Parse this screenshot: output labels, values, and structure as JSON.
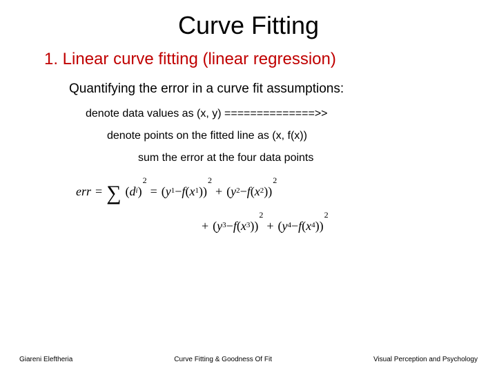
{
  "title": "Curve Fitting",
  "subtitle": "1. Linear curve fitting (linear regression)",
  "lines": {
    "l1": "Quantifying the error in a curve fit assumptions:",
    "l2": "denote data values as (x, y) ==============>>",
    "l3": "denote points on the fitted line as (x, f(x))",
    "l4": "sum the error at the four data points"
  },
  "equation": {
    "lhs_err": "err",
    "eq": "=",
    "sum": "∑",
    "d_open": "(",
    "d_var": "d",
    "d_sub": "i",
    "d_close": ")",
    "sq": "2",
    "y": "y",
    "f": "f",
    "x": "x",
    "minus": "−",
    "plus": "+",
    "open": "(",
    "close": ")",
    "s1": "1",
    "s2": "2",
    "s3": "3",
    "s4": "4"
  },
  "footer": {
    "left": "Giareni Eleftheria",
    "center": "Curve Fitting & Goodness Of Fit",
    "right": "Visual Perception and Psychology"
  }
}
